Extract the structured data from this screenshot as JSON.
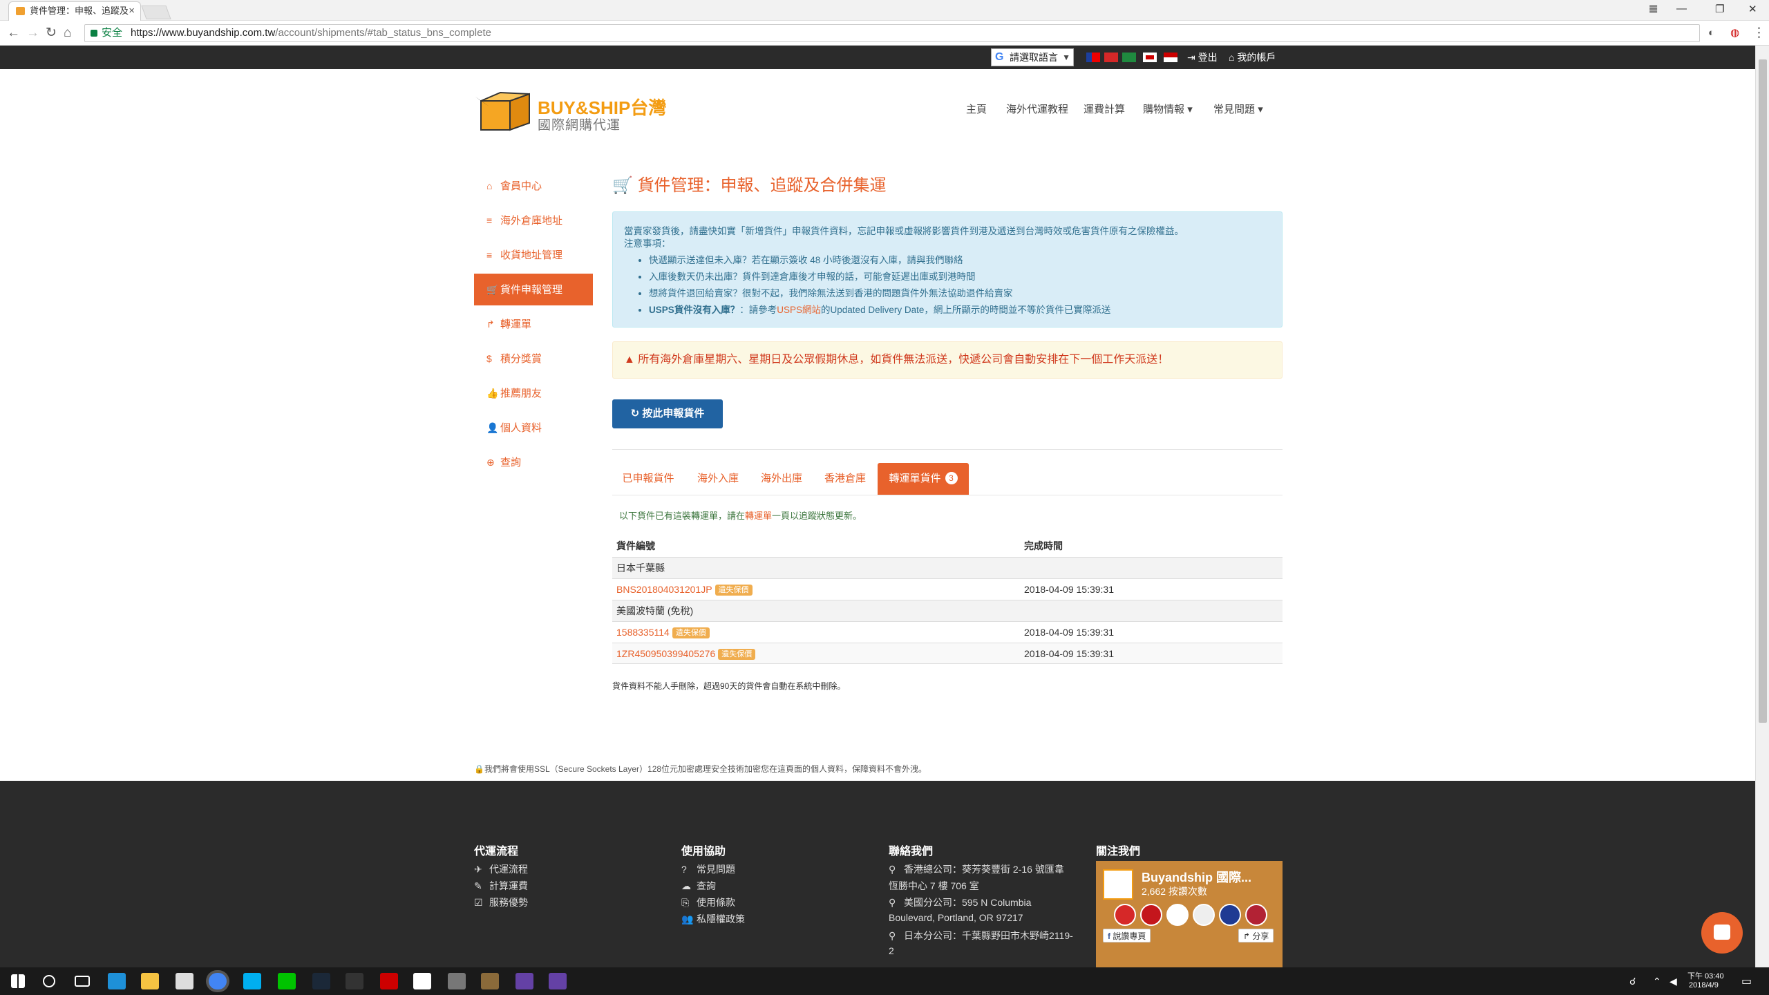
{
  "browser": {
    "tab_title": "貨件管理：申報、追蹤及",
    "tab_close": "×",
    "window_controls": [
      "𝌆",
      "—",
      "❐",
      "✕"
    ],
    "secure_label": "安全",
    "url_host": "https://www.buyandship.com.tw",
    "url_path": "/account/shipments/#tab_status_bns_complete",
    "star": "☆"
  },
  "topbar": {
    "translate_label": "請選取語言",
    "translate_dropdown": "▼",
    "logout": "登出",
    "my_account": "我的帳戶",
    "colors": {
      "bg": "#2b2b2b"
    }
  },
  "header": {
    "logo_main": "BUY&SHIP台灣",
    "logo_sub": "國際網購代運",
    "nav": [
      "主頁",
      "海外代運教程",
      "運費計算",
      "購物情報",
      "常見問題"
    ],
    "nav_caret": "▾"
  },
  "sidebar": {
    "items": [
      {
        "label": "會員中心",
        "icon": "home-icon",
        "glyph": "⌂"
      },
      {
        "label": "海外倉庫地址",
        "icon": "list-icon",
        "glyph": "≡"
      },
      {
        "label": "收貨地址管理",
        "icon": "list-icon",
        "glyph": "≡"
      },
      {
        "label": "貨件申報管理",
        "icon": "cart-icon",
        "glyph": "🛒"
      },
      {
        "label": "轉運單",
        "icon": "share-icon",
        "glyph": "↱"
      },
      {
        "label": "積分獎賞",
        "icon": "dollar-icon",
        "glyph": "$"
      },
      {
        "label": "推薦朋友",
        "icon": "thumbs-up-icon",
        "glyph": "👍"
      },
      {
        "label": "個人資料",
        "icon": "user-icon",
        "glyph": "👤"
      },
      {
        "label": "查詢",
        "icon": "lifebuoy-icon",
        "glyph": "⊕"
      }
    ],
    "active_index": 3
  },
  "main": {
    "title": "貨件管理：申報、追蹤及合併集運",
    "title_icon": "🛒",
    "info": {
      "intro": "當賣家發貨後，請盡快如實「新增貨件」申報貨件資料，忘記申報或虛報將影響貨件到港及遞送到台灣時效或危害貨件原有之保險權益。",
      "notice_label": "注意事項：",
      "bullets": [
        "快遞顯示送達但未入庫？若在顯示簽收 48 小時後還沒有入庫，請與我們聯絡",
        "入庫後數天仍未出庫？貨件到達倉庫後才申報的話，可能會延遲出庫或到港時間",
        "想將貨件退回給賣家？很對不起，我們除無法送到香港的問題貨件外無法協助退件給賣家"
      ],
      "usps_bold": "USPS貨件沒有入庫？",
      "usps_text1": "：請參考",
      "usps_link": "USPS網站",
      "usps_text2": "的Updated Delivery Date，網上所顯示的時間並不等於貨件已實際派送"
    },
    "warning": "所有海外倉庫星期六、星期日及公眾假期休息，如貨件無法派送，快遞公司會自動安排在下一個工作天派送！",
    "warning_icon": "▲",
    "declare_button": "按此申報貨件",
    "declare_icon": "↻",
    "tabs": [
      {
        "label": "已申報貨件"
      },
      {
        "label": "海外入庫"
      },
      {
        "label": "海外出庫"
      },
      {
        "label": "香港倉庫"
      },
      {
        "label": "轉運單貨件",
        "badge": "3"
      }
    ],
    "active_tab": 4,
    "note_pre": "以下貨件已有這裝轉運單，請在",
    "note_link": "轉運單",
    "note_post": "一頁以追蹤狀態更新。",
    "table": {
      "headers": [
        "貨件編號",
        "完成時間"
      ],
      "groups": [
        {
          "name": "日本千葉縣",
          "rows": [
            {
              "number": "BNS201804031201JP",
              "tag": "遺失保價",
              "time": "2018-04-09 15:39:31"
            }
          ]
        },
        {
          "name": "美國波特蘭 (免稅)",
          "rows": [
            {
              "number": "1588335114",
              "tag": "遺失保價",
              "time": "2018-04-09 15:39:31"
            },
            {
              "number": "1ZR450950399405276",
              "tag": "遺失保價",
              "time": "2018-04-09 15:39:31"
            }
          ]
        }
      ]
    },
    "footnote": "貨件資料不能人手刪除，超過90天的貨件會自動在系統中刪除。"
  },
  "ssl_note": "我們將會使用SSL（Secure Sockets Layer）128位元加密處理安全技術加密您在這頁面的個人資料，保障資料不會外洩。",
  "footer": {
    "col1": {
      "title": "代運流程",
      "items": [
        {
          "label": "代運流程",
          "glyph": "✈"
        },
        {
          "label": "計算運費",
          "glyph": "✎"
        },
        {
          "label": "服務優勢",
          "glyph": "☑"
        }
      ]
    },
    "col2": {
      "title": "使用協助",
      "items": [
        {
          "label": "常見問題",
          "glyph": "?"
        },
        {
          "label": "查詢",
          "glyph": "☁"
        },
        {
          "label": "使用條款",
          "glyph": "⎘"
        },
        {
          "label": "私隱權政策",
          "glyph": "👥"
        }
      ]
    },
    "col3": {
      "title": "聯絡我們",
      "lines": [
        "香港總公司：葵芳葵豐街 2-16 號匯韋",
        "恆勝中心 7 樓 706 室",
        "美國分公司：595 N Columbia",
        "Boulevard, Portland, OR 97217",
        "日本分公司：千葉縣野田市木野崎2119-",
        "2"
      ],
      "pin": "⚲"
    },
    "col4": {
      "title": "關注我們",
      "fb_name": "Buyandship 國際...",
      "fb_likes": "2,662 按讚次數",
      "fb_like_btn": "說讚專頁",
      "fb_share_btn": "分享"
    }
  },
  "taskbar": {
    "time": "下午 03:40",
    "date": "2018/4/9"
  }
}
